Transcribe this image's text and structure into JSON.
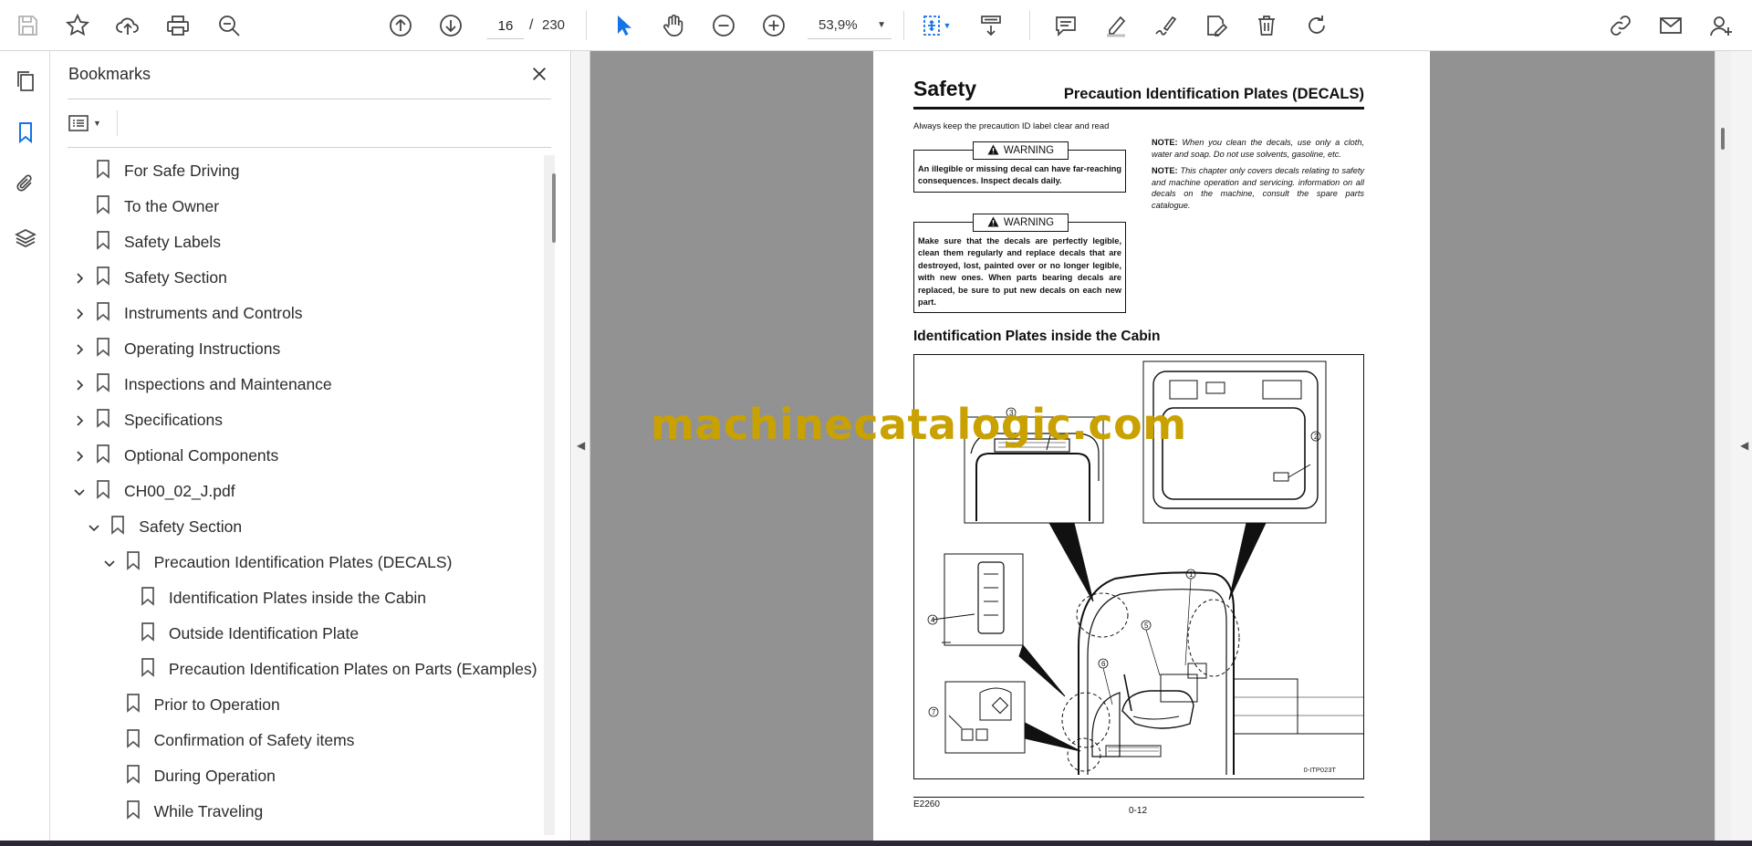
{
  "toolbar": {
    "page_current": "16",
    "page_separator": "/",
    "page_total": "230",
    "zoom": "53,9%"
  },
  "bookmarks_panel": {
    "title": "Bookmarks",
    "items": [
      {
        "label": "For Safe Driving",
        "expand": "none"
      },
      {
        "label": "To the Owner",
        "expand": "none"
      },
      {
        "label": "Safety Labels",
        "expand": "none"
      },
      {
        "label": "Safety Section",
        "expand": "collapsed"
      },
      {
        "label": "Instruments and Controls",
        "expand": "collapsed"
      },
      {
        "label": "Operating Instructions",
        "expand": "collapsed"
      },
      {
        "label": "Inspections and Maintenance",
        "expand": "collapsed"
      },
      {
        "label": "Specifications",
        "expand": "collapsed"
      },
      {
        "label": "Optional Components",
        "expand": "collapsed"
      },
      {
        "label": "CH00_02_J.pdf",
        "expand": "expanded"
      },
      {
        "label": "Safety Section",
        "expand": "expanded"
      },
      {
        "label": "Precaution Identification Plates (DECALS)",
        "expand": "expanded"
      },
      {
        "label": "Identification Plates inside the Cabin",
        "expand": "none"
      },
      {
        "label": "Outside Identification Plate",
        "expand": "none"
      },
      {
        "label": "Precaution Identification Plates on Parts (Examples)",
        "expand": "none"
      },
      {
        "label": "Prior to Operation",
        "expand": "none"
      },
      {
        "label": "Confirmation of Safety items",
        "expand": "none"
      },
      {
        "label": "During Operation",
        "expand": "none"
      },
      {
        "label": "While Traveling",
        "expand": "none"
      }
    ]
  },
  "document_page": {
    "section": "Safety",
    "heading": "Precaution Identification Plates (DECALS)",
    "intro": "Always keep the precaution ID label clear and read",
    "warning1_tag": "WARNING",
    "warning1_text": "An illegible or missing decal can have far-reaching consequences. Inspect decals daily.",
    "warning2_tag": "WARNING",
    "warning2_text": "Make sure that the decals are perfectly legible, clean them regularly and replace decals that are destroyed, lost, painted over or no longer legible, with new ones. When parts bearing decals are replaced, be sure to put new decals on each new part.",
    "note1_label": "NOTE:",
    "note1_text": "When you clean the decals, use only a cloth, water and soap. Do not use solvents, gasoline, etc.",
    "note2_label": "NOTE:",
    "note2_text": "This chapter only covers decals relating to safety and machine operation and servicing. information on all decals on the machine, consult the spare parts catalogue.",
    "subheading": "Identification Plates inside the Cabin",
    "figure_code": "0-ITP023T",
    "callouts": [
      "1",
      "2",
      "3",
      "4",
      "5",
      "6",
      "7"
    ],
    "footer_model": "E2260",
    "footer_page": "0-12"
  },
  "watermark": "machinecatalogic.com",
  "colors": {
    "accent_blue": "#1473e6",
    "viewer_gray": "#929292",
    "watermark": "#c9a100"
  }
}
